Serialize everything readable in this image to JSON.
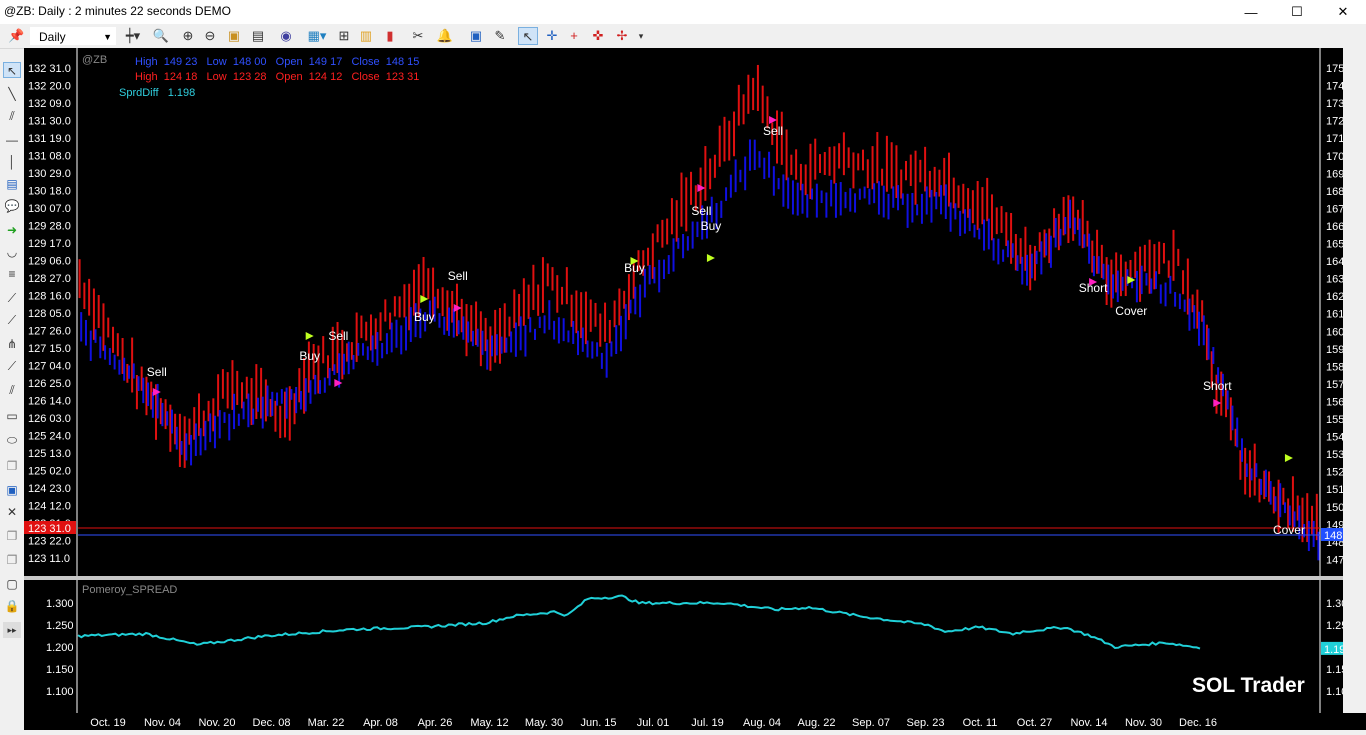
{
  "window": {
    "title": "@ZB: Daily : 2 minutes 22 seconds DEMO",
    "minimize": "—",
    "maximize": "☐",
    "close": "✕"
  },
  "toolbar": {
    "interval": "Daily"
  },
  "chart": {
    "symbol": "@ZB",
    "info_line1": "High  149 23   Low  148 00   Open  149 17   Close  148 15",
    "info_line2": "High  124 18   Low  123 28   Open  124 12   Close  123 31",
    "info_line3": "SprdDiff   1.198",
    "left_axis": [
      "132 31.0",
      "132 20.0",
      "132 09.0",
      "131 30.0",
      "131 19.0",
      "131 08.0",
      "130 29.0",
      "130 18.0",
      "130 07.0",
      "129 28.0",
      "129 17.0",
      "129 06.0",
      "128 27.0",
      "128 16.0",
      "128 05.0",
      "127 26.0",
      "127 15.0",
      "127 04.0",
      "126 25.0",
      "126 14.0",
      "126 03.0",
      "125 24.0",
      "125 13.0",
      "125 02.0",
      "124 23.0",
      "124 12.0",
      "123 31.0",
      "123 22.0",
      "123 11.0"
    ],
    "right_axis": [
      "175 00",
      "174 00",
      "173 00",
      "172 00",
      "171 00",
      "170 00",
      "169 00",
      "168 00",
      "167 00",
      "166 00",
      "165 00",
      "164 00",
      "163 00",
      "162 00",
      "161 00",
      "160 00",
      "159 00",
      "158 00",
      "157 00",
      "156 00",
      "155 00",
      "154 00",
      "153 00",
      "152 00",
      "151 00",
      "150 00",
      "149 00",
      "148 00",
      "147 00"
    ],
    "left_last": "123 31.0",
    "right_last": "148 15",
    "colors": {
      "red_series": "#e01010",
      "blue_series": "#1010e0",
      "spread": "#20d0d8",
      "background": "#000000"
    },
    "signals": [
      {
        "label": "Sell",
        "x": 16
      },
      {
        "label": "Buy",
        "x": 48
      },
      {
        "label": "Sell",
        "x": 54
      },
      {
        "label": "Buy",
        "x": 72
      },
      {
        "label": "Sell",
        "x": 79
      },
      {
        "label": "Buy",
        "x": 116
      },
      {
        "label": "Sell",
        "x": 130
      },
      {
        "label": "Buy",
        "x": 132
      },
      {
        "label": "Sell",
        "x": 145
      },
      {
        "label": "Short",
        "x": 212
      },
      {
        "label": "Cover",
        "x": 220
      },
      {
        "label": "Short",
        "x": 238
      },
      {
        "label": "Cover",
        "x": 253
      }
    ]
  },
  "indicator": {
    "name": "Pomeroy_SPREAD",
    "axis": [
      "1.300",
      "1.250",
      "1.200",
      "1.150",
      "1.100"
    ],
    "last": "1.198",
    "watermark": "SOL Trader"
  },
  "dates": [
    "Oct. 19",
    "Nov. 04",
    "Nov. 20",
    "Dec. 08",
    "Mar. 22",
    "Apr. 08",
    "Apr. 26",
    "May. 12",
    "May. 30",
    "Jun. 15",
    "Jul. 01",
    "Jul. 19",
    "Aug. 04",
    "Aug. 22",
    "Sep. 07",
    "Sep. 23",
    "Oct. 11",
    "Oct. 27",
    "Nov. 14",
    "Nov. 30",
    "Dec. 16"
  ],
  "chart_data": {
    "type": "bar",
    "bars_per_date_label": 11,
    "count": 260,
    "series": [
      {
        "name": "@ZB",
        "color": "#e01010",
        "axis": "right",
        "anchors": [
          [
            0,
            163
          ],
          [
            12,
            157
          ],
          [
            22,
            154
          ],
          [
            32,
            157
          ],
          [
            43,
            155
          ],
          [
            48,
            158
          ],
          [
            55,
            159
          ],
          [
            65,
            161
          ],
          [
            73,
            163
          ],
          [
            86,
            159
          ],
          [
            98,
            163
          ],
          [
            110,
            160
          ],
          [
            118,
            164
          ],
          [
            126,
            167
          ],
          [
            134,
            170
          ],
          [
            141,
            174
          ],
          [
            150,
            169
          ],
          [
            160,
            170
          ],
          [
            170,
            169
          ],
          [
            180,
            169
          ],
          [
            190,
            167
          ],
          [
            199,
            164
          ],
          [
            207,
            167
          ],
          [
            215,
            163
          ],
          [
            223,
            164
          ],
          [
            230,
            164
          ],
          [
            235,
            161
          ],
          [
            238,
            157
          ],
          [
            244,
            152
          ],
          [
            252,
            150
          ],
          [
            259,
            149
          ]
        ]
      },
      {
        "name": "@ZB 2",
        "color": "#1010e0",
        "axis": "left",
        "anchors": [
          [
            0,
            127.8
          ],
          [
            12,
            126.9
          ],
          [
            22,
            125.5
          ],
          [
            32,
            126.1
          ],
          [
            43,
            126.5
          ],
          [
            48,
            126.6
          ],
          [
            55,
            127.2
          ],
          [
            65,
            127.6
          ],
          [
            73,
            128.2
          ],
          [
            86,
            127.4
          ],
          [
            98,
            128.0
          ],
          [
            110,
            127.3
          ],
          [
            118,
            128.7
          ],
          [
            126,
            129.5
          ],
          [
            134,
            130.3
          ],
          [
            141,
            131.3
          ],
          [
            150,
            130.3
          ],
          [
            160,
            130.5
          ],
          [
            170,
            130.3
          ],
          [
            180,
            130.3
          ],
          [
            190,
            129.6
          ],
          [
            199,
            129.0
          ],
          [
            207,
            130.0
          ],
          [
            215,
            128.7
          ],
          [
            223,
            128.8
          ],
          [
            230,
            128.5
          ],
          [
            235,
            127.8
          ],
          [
            238,
            126.9
          ],
          [
            244,
            125.2
          ],
          [
            252,
            124.3
          ],
          [
            259,
            123.6
          ]
        ]
      }
    ],
    "indicator": {
      "name": "Pomeroy_SPREAD",
      "color": "#20d0d8",
      "anchors": [
        [
          0,
          1.225
        ],
        [
          20,
          1.23
        ],
        [
          35,
          1.205
        ],
        [
          55,
          1.225
        ],
        [
          80,
          1.24
        ],
        [
          100,
          1.245
        ],
        [
          120,
          1.255
        ],
        [
          128,
          1.27
        ],
        [
          140,
          1.28
        ],
        [
          144,
          1.272
        ],
        [
          150,
          1.31
        ],
        [
          160,
          1.315
        ],
        [
          165,
          1.3
        ],
        [
          180,
          1.3
        ],
        [
          190,
          1.3
        ],
        [
          205,
          1.285
        ],
        [
          215,
          1.29
        ],
        [
          230,
          1.27
        ],
        [
          250,
          1.25
        ],
        [
          255,
          1.235
        ],
        [
          265,
          1.245
        ],
        [
          275,
          1.23
        ],
        [
          278,
          1.235
        ],
        [
          290,
          1.245
        ],
        [
          298,
          1.225
        ],
        [
          305,
          1.2
        ],
        [
          320,
          1.21
        ],
        [
          330,
          1.198
        ]
      ]
    }
  }
}
